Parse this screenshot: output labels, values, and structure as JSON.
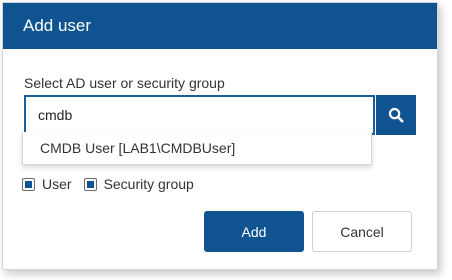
{
  "dialog": {
    "title": "Add user",
    "field_label": "Select AD user or security group",
    "search": {
      "value": "cmdb",
      "icon": "search-icon"
    },
    "suggestions": [
      "CMDB User [LAB1\\CMDBUser]"
    ],
    "filters": [
      {
        "label": "User",
        "checked": true
      },
      {
        "label": "Security group",
        "checked": true
      }
    ],
    "buttons": {
      "add_label": "Add",
      "cancel_label": "Cancel"
    }
  },
  "colors": {
    "accent": "#0f5491",
    "border": "#d6d6d6",
    "text": "#333333"
  }
}
